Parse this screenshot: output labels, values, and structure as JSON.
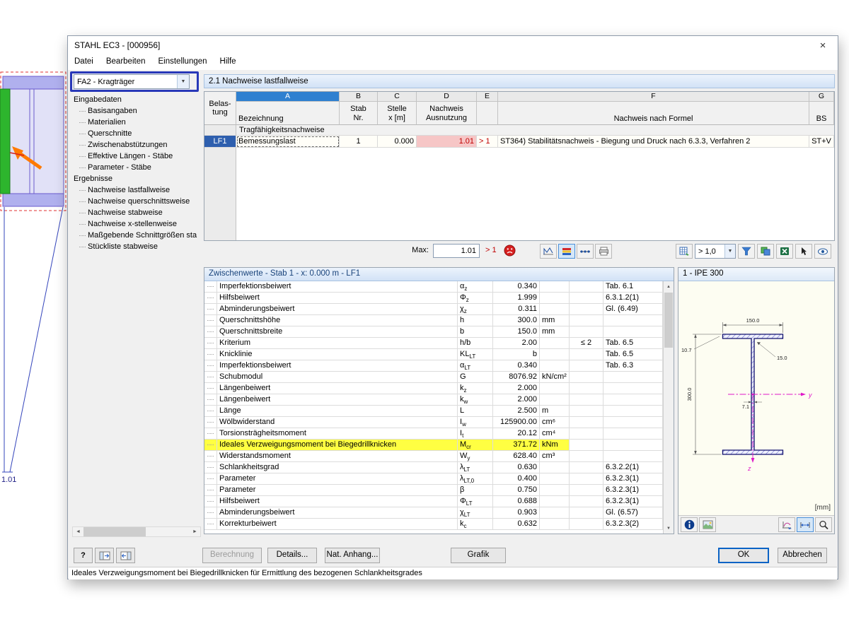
{
  "window": {
    "title": "STAHL EC3 - [000956]",
    "close_glyph": "×"
  },
  "menu": {
    "items": [
      "Datei",
      "Bearbeiten",
      "Einstellungen",
      "Hilfe"
    ]
  },
  "case_selector": {
    "value": "FA2 - Kragträger"
  },
  "glyphs": {
    "dropdown": "▼",
    "scroll_left": "◄",
    "scroll_right": "►",
    "scroll_up": "▲",
    "scroll_down": "▼",
    "help": "?"
  },
  "nav": {
    "sections": [
      {
        "label": "Eingabedaten",
        "children": [
          "Basisangaben",
          "Materialien",
          "Querschnitte",
          "Zwischenabstützungen",
          "Effektive Längen - Stäbe",
          "Parameter - Stäbe"
        ]
      },
      {
        "label": "Ergebnisse",
        "children": [
          "Nachweise lastfallweise",
          "Nachweise querschnittsweise",
          "Nachweise stabweise",
          "Nachweise x-stellenweise",
          "Maßgebende Schnittgrößen sta",
          "Stückliste stabweise"
        ]
      }
    ]
  },
  "results": {
    "caption": "2.1 Nachweise lastfallweise",
    "letters": [
      "A",
      "B",
      "C",
      "D",
      "E",
      "F",
      "G"
    ],
    "headers": {
      "load1": "Belas-",
      "load2": "tung",
      "a": "Bezeichnung",
      "b1": "Stab",
      "b2": "Nr.",
      "c1": "Stelle",
      "c2": "x [m]",
      "d1": "Nachweis",
      "d2": "Ausnutzung",
      "f": "Nachweis nach Formel",
      "g": "BS"
    },
    "section_label": "Tragfähigkeitsnachweise",
    "row": {
      "load": "LF1",
      "name": "Bemessungslast",
      "member": "1",
      "x": "0.000",
      "ratio": "1.01",
      "flag": "> 1",
      "formula": "ST364) Stabilitätsnachweis - Biegung und Druck nach 6.3.3, Verfahren 2",
      "bs": "ST+V"
    },
    "max_label": "Max:",
    "max_value": "1.01",
    "max_flag": "> 1",
    "filter_value": "> 1,0"
  },
  "intermediate": {
    "caption": "Zwischenwerte - Stab 1 - x: 0.000 m - LF1",
    "rows": [
      {
        "desc": "Imperfektionsbeiwert",
        "sym": "α",
        "sub": "z",
        "val": "0.340",
        "unit": "",
        "crit": "",
        "ref": "Tab. 6.1"
      },
      {
        "desc": "Hilfsbeiwert",
        "sym": "Φ",
        "sub": "z",
        "val": "1.999",
        "unit": "",
        "crit": "",
        "ref": "6.3.1.2(1)"
      },
      {
        "desc": "Abminderungsbeiwert",
        "sym": "χ",
        "sub": "z",
        "val": "0.311",
        "unit": "",
        "crit": "",
        "ref": "Gl. (6.49)"
      },
      {
        "desc": "Querschnittshöhe",
        "sym": "h",
        "sub": "",
        "val": "300.0",
        "unit": "mm",
        "crit": "",
        "ref": ""
      },
      {
        "desc": "Querschnittsbreite",
        "sym": "b",
        "sub": "",
        "val": "150.0",
        "unit": "mm",
        "crit": "",
        "ref": ""
      },
      {
        "desc": "Kriterium",
        "sym": "h/b",
        "sub": "",
        "val": "2.00",
        "unit": "",
        "crit": "≤ 2",
        "ref": "Tab. 6.5"
      },
      {
        "desc": "Knicklinie",
        "sym": "KL",
        "sub": "LT",
        "val": "b",
        "unit": "",
        "crit": "",
        "ref": "Tab. 6.5"
      },
      {
        "desc": "Imperfektionsbeiwert",
        "sym": "α",
        "sub": "LT",
        "val": "0.340",
        "unit": "",
        "crit": "",
        "ref": "Tab. 6.3"
      },
      {
        "desc": "Schubmodul",
        "sym": "G",
        "sub": "",
        "val": "8076.92",
        "unit": "kN/cm²",
        "crit": "",
        "ref": ""
      },
      {
        "desc": "Längenbeiwert",
        "sym": "k",
        "sub": "z",
        "val": "2.000",
        "unit": "",
        "crit": "",
        "ref": ""
      },
      {
        "desc": "Längenbeiwert",
        "sym": "k",
        "sub": "w",
        "val": "2.000",
        "unit": "",
        "crit": "",
        "ref": ""
      },
      {
        "desc": "Länge",
        "sym": "L",
        "sub": "",
        "val": "2.500",
        "unit": "m",
        "crit": "",
        "ref": ""
      },
      {
        "desc": "Wölbwiderstand",
        "sym": "I",
        "sub": "w",
        "val": "125900.00",
        "unit": "cm⁶",
        "crit": "",
        "ref": ""
      },
      {
        "desc": "Torsionsträgheitsmoment",
        "sym": "I",
        "sub": "t",
        "val": "20.12",
        "unit": "cm⁴",
        "crit": "",
        "ref": ""
      },
      {
        "desc": "Ideales Verzweigungsmoment bei Biegedrillknicken",
        "sym": "M",
        "sub": "cr",
        "val": "371.72",
        "unit": "kNm",
        "crit": "",
        "ref": "",
        "hl": true
      },
      {
        "desc": "Widerstandsmoment",
        "sym": "W",
        "sub": "y",
        "val": "628.40",
        "unit": "cm³",
        "crit": "",
        "ref": ""
      },
      {
        "desc": "Schlankheitsgrad",
        "sym": "λ",
        "sub": "LT",
        "val": "0.630",
        "unit": "",
        "crit": "",
        "ref": "6.3.2.2(1)"
      },
      {
        "desc": "Parameter",
        "sym": "λ",
        "sub": "LT,0",
        "val": "0.400",
        "unit": "",
        "crit": "",
        "ref": "6.3.2.3(1)"
      },
      {
        "desc": "Parameter",
        "sym": "β",
        "sub": "",
        "val": "0.750",
        "unit": "",
        "crit": "",
        "ref": "6.3.2.3(1)"
      },
      {
        "desc": "Hilfsbeiwert",
        "sym": "Φ",
        "sub": "LT",
        "val": "0.688",
        "unit": "",
        "crit": "",
        "ref": "6.3.2.3(1)"
      },
      {
        "desc": "Abminderungsbeiwert",
        "sym": "χ",
        "sub": "LT",
        "val": "0.903",
        "unit": "",
        "crit": "",
        "ref": "Gl. (6.57)"
      },
      {
        "desc": "Korrekturbeiwert",
        "sym": "k",
        "sub": "c",
        "val": "0.632",
        "unit": "",
        "crit": "",
        "ref": "6.3.2.3(2)"
      }
    ]
  },
  "section_panel": {
    "caption": "1 - IPE 300",
    "dim_width": "150.0",
    "dim_tf": "10.7",
    "dim_r": "15.0",
    "dim_h": "300.0",
    "dim_tw": "7.1",
    "axis_y": "y",
    "axis_z": "z",
    "units": "[mm]"
  },
  "footer": {
    "berechnung": "Berechnung",
    "details": "Details...",
    "anhang": "Nat. Anhang...",
    "grafik": "Grafik",
    "ok": "OK",
    "abbrechen": "Abbrechen"
  },
  "statusbar": "Ideales Verzweigungsmoment bei Biegedrillknicken für Ermittlung des bezogenen Schlankheitsgrades",
  "viewport": {
    "max_label": "1.01"
  }
}
